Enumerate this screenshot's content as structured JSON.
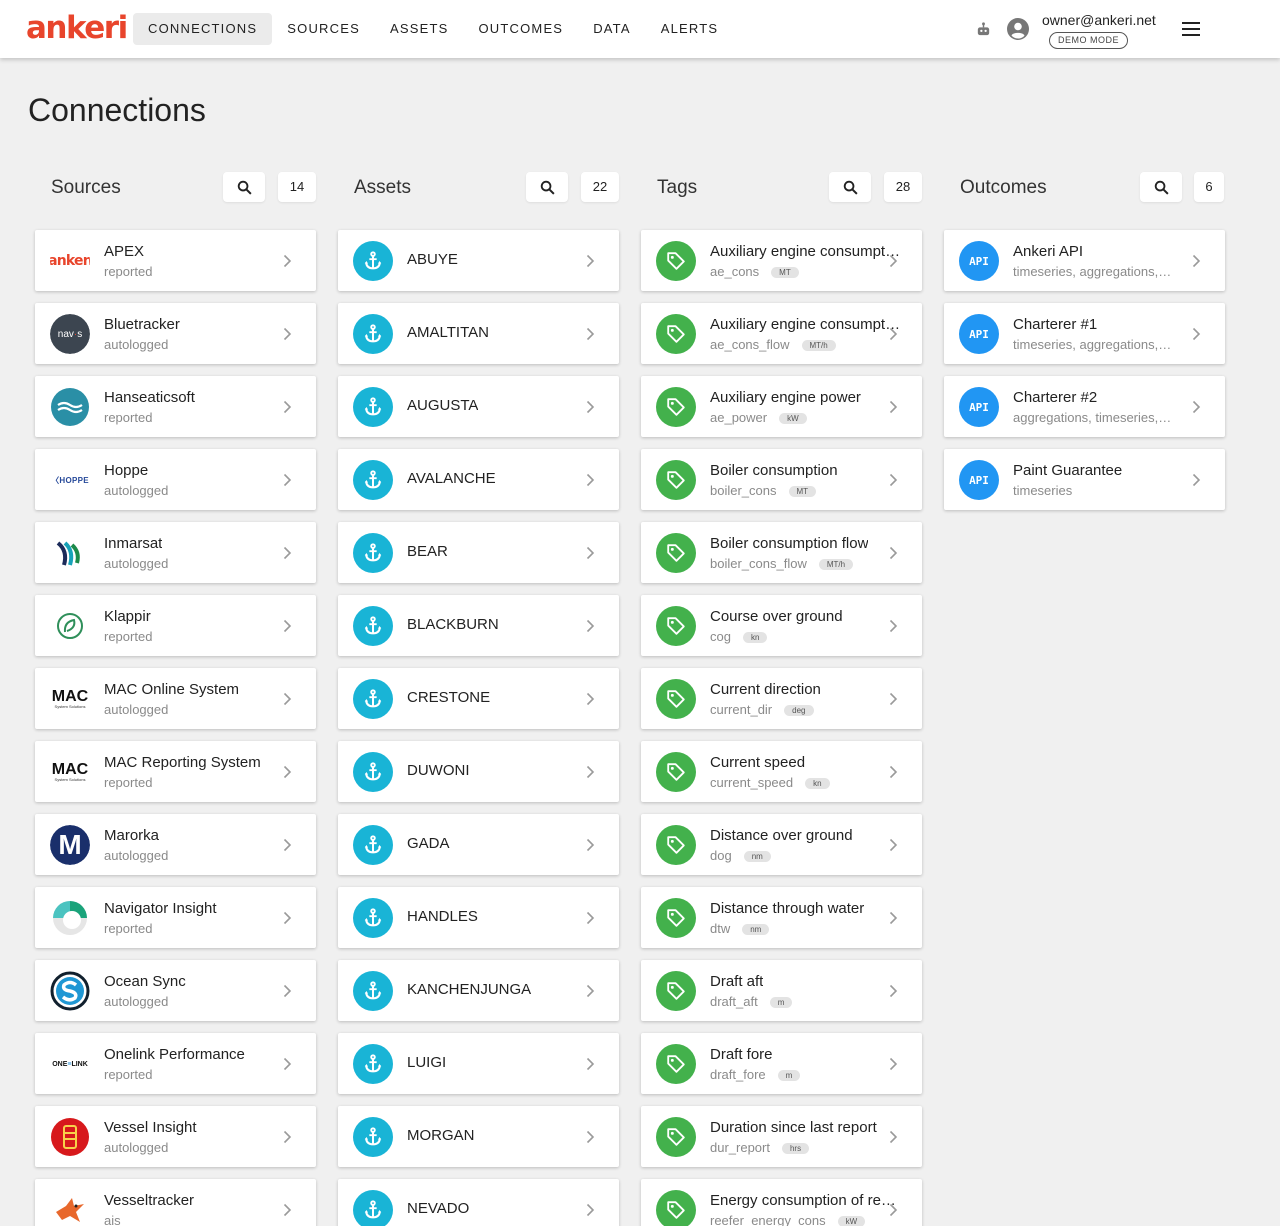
{
  "app": {
    "logo": "ankeri",
    "nav": [
      "CONNECTIONS",
      "SOURCES",
      "ASSETS",
      "OUTCOMES",
      "DATA",
      "ALERTS"
    ],
    "user_email": "owner@ankeri.net",
    "demo_badge": "DEMO MODE"
  },
  "page": {
    "title": "Connections"
  },
  "columns": {
    "sources": {
      "title": "Sources",
      "count": "14",
      "items": [
        {
          "name": "APEX",
          "sub": "reported",
          "logo": "ankeri"
        },
        {
          "name": "Bluetracker",
          "sub": "autologged",
          "logo": "navis"
        },
        {
          "name": "Hanseaticsoft",
          "sub": "reported",
          "logo": "waves"
        },
        {
          "name": "Hoppe",
          "sub": "autologged",
          "logo": "HOPPE"
        },
        {
          "name": "Inmarsat",
          "sub": "autologged",
          "logo": "inmarsat"
        },
        {
          "name": "Klappir",
          "sub": "reported",
          "logo": "klappir"
        },
        {
          "name": "MAC Online System",
          "sub": "autologged",
          "logo": "MAC"
        },
        {
          "name": "MAC Reporting System",
          "sub": "reported",
          "logo": "MAC"
        },
        {
          "name": "Marorka",
          "sub": "autologged",
          "logo": "M"
        },
        {
          "name": "Navigator Insight",
          "sub": "reported",
          "logo": "navigator"
        },
        {
          "name": "Ocean Sync",
          "sub": "autologged",
          "logo": "S"
        },
        {
          "name": "Onelink Performance",
          "sub": "reported",
          "logo": "ONELINK"
        },
        {
          "name": "Vessel Insight",
          "sub": "autologged",
          "logo": "vessel"
        },
        {
          "name": "Vesseltracker",
          "sub": "ais",
          "logo": "bird"
        }
      ]
    },
    "assets": {
      "title": "Assets",
      "count": "22",
      "items": [
        "ABUYE",
        "AMALTITAN",
        "AUGUSTA",
        "AVALANCHE",
        "BEAR",
        "BLACKBURN",
        "CRESTONE",
        "DUWONI",
        "GADA",
        "HANDLES",
        "KANCHENJUNGA",
        "LUIGI",
        "MORGAN",
        "NEVADO"
      ]
    },
    "tags": {
      "title": "Tags",
      "count": "28",
      "items": [
        {
          "name": "Auxiliary engine consumpt…",
          "key": "ae_cons",
          "unit": "MT"
        },
        {
          "name": "Auxiliary engine consumpt…",
          "key": "ae_cons_flow",
          "unit": "MT/h"
        },
        {
          "name": "Auxiliary engine power",
          "key": "ae_power",
          "unit": "kW"
        },
        {
          "name": "Boiler consumption",
          "key": "boiler_cons",
          "unit": "MT"
        },
        {
          "name": "Boiler consumption flow",
          "key": "boiler_cons_flow",
          "unit": "MT/h"
        },
        {
          "name": "Course over ground",
          "key": "cog",
          "unit": "kn"
        },
        {
          "name": "Current direction",
          "key": "current_dir",
          "unit": "deg"
        },
        {
          "name": "Current speed",
          "key": "current_speed",
          "unit": "kn"
        },
        {
          "name": "Distance over ground",
          "key": "dog",
          "unit": "nm"
        },
        {
          "name": "Distance through water",
          "key": "dtw",
          "unit": "nm"
        },
        {
          "name": "Draft aft",
          "key": "draft_aft",
          "unit": "m"
        },
        {
          "name": "Draft fore",
          "key": "draft_fore",
          "unit": "m"
        },
        {
          "name": "Duration since last report",
          "key": "dur_report",
          "unit": "hrs"
        },
        {
          "name": "Energy consumption of re…",
          "key": "reefer_energy_cons",
          "unit": "kW"
        }
      ]
    },
    "outcomes": {
      "title": "Outcomes",
      "count": "6",
      "items": [
        {
          "name": "Ankeri API",
          "sub": "timeseries, aggregations,…",
          "icon": "API"
        },
        {
          "name": "Charterer #1",
          "sub": "timeseries, aggregations,…",
          "icon": "API"
        },
        {
          "name": "Charterer #2",
          "sub": "aggregations, timeseries,…",
          "icon": "API"
        },
        {
          "name": "Paint Guarantee",
          "sub": "timeseries",
          "icon": "API"
        }
      ]
    }
  },
  "colors": {
    "brand": "#e8452c",
    "anchor": "#19b4d6",
    "tag": "#43b14c",
    "api": "#2196f3"
  }
}
